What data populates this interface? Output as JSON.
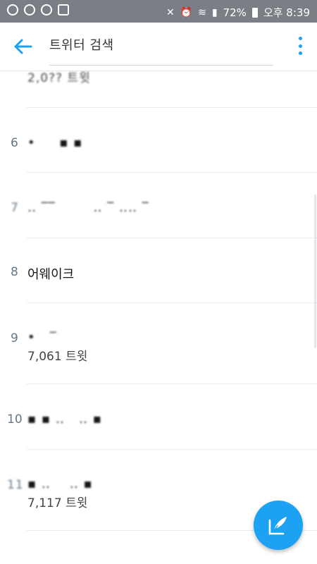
{
  "status_bar": {
    "battery": "72%",
    "time": "오후 8:39"
  },
  "appbar": {
    "search_text": "트위터 검색"
  },
  "trends": [
    {
      "rank": "",
      "name": "",
      "count": "2,0?? 트윗"
    },
    {
      "rank": "6",
      "name": "",
      "count": ""
    },
    {
      "rank": "7",
      "name": "",
      "count": ""
    },
    {
      "rank": "8",
      "name": "어웨이크",
      "count": ""
    },
    {
      "rank": "9",
      "name": "",
      "count": "7,061 트윗"
    },
    {
      "rank": "10",
      "name": "",
      "count": ""
    },
    {
      "rank": "11",
      "name": "",
      "count": "7,117 트윗"
    }
  ],
  "colors": {
    "accent": "#1da1f2",
    "status_bar": "#7a7f85"
  },
  "icons": {
    "back": "arrow-back-icon",
    "more": "more-vert-icon",
    "compose": "compose-tweet-icon"
  }
}
